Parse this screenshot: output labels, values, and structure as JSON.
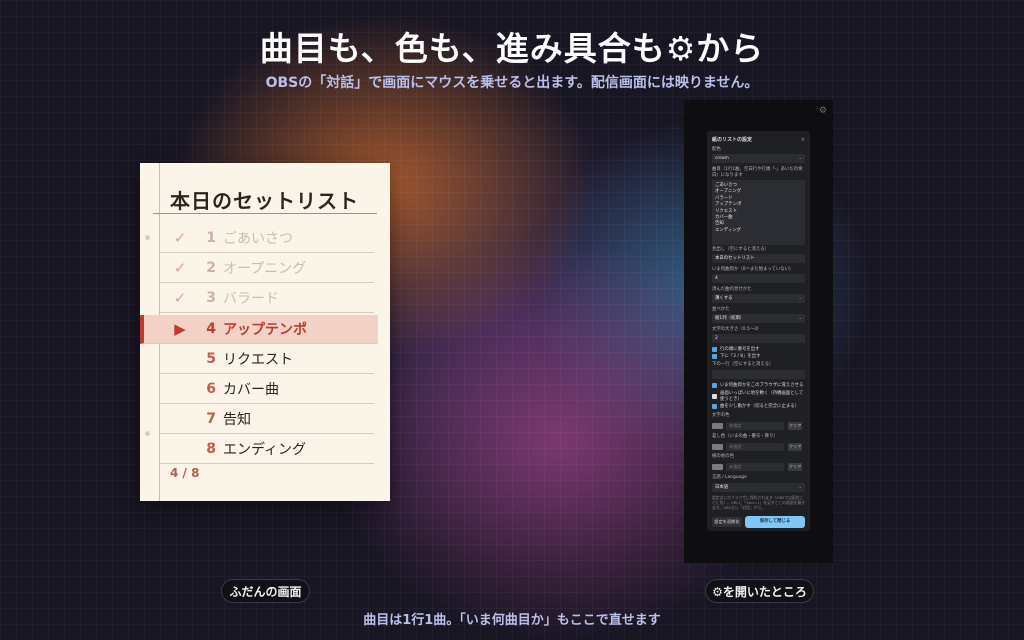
{
  "header": {
    "title": "曲目も、色も、進み具合も⚙から",
    "subtitle": "OBSの「対話」で画面にマウスを乗せると出ます。配信画面には映りません。"
  },
  "footer_text": "曲目は1行1曲。「いま何曲目か」もここで直せます",
  "captions": {
    "left": "ふだんの画面",
    "right": "⚙を開いたところ"
  },
  "setlist": {
    "title": "本日のセットリスト",
    "rows": [
      {
        "mark": "✓",
        "num": "1",
        "label": "ごあいさつ",
        "state": "done"
      },
      {
        "mark": "✓",
        "num": "2",
        "label": "オープニング",
        "state": "done"
      },
      {
        "mark": "✓",
        "num": "3",
        "label": "バラード",
        "state": "done"
      },
      {
        "mark": "▶",
        "num": "4",
        "label": "アップテンポ",
        "state": "current"
      },
      {
        "mark": "",
        "num": "5",
        "label": "リクエスト",
        "state": "todo"
      },
      {
        "mark": "",
        "num": "6",
        "label": "カバー曲",
        "state": "todo"
      },
      {
        "mark": "",
        "num": "7",
        "label": "告知",
        "state": "todo"
      },
      {
        "mark": "",
        "num": "8",
        "label": "エンディング",
        "state": "todo"
      }
    ],
    "progress": "4 / 8"
  },
  "settings": {
    "gear": "⚙",
    "title": "紙のリストの設定",
    "close": "×",
    "palette_label": "配色",
    "palette_value": "cream",
    "songs_label": "曲目（1行1曲。空白行や行頭「-」あいだの余白）になります",
    "songs_value": "ごあいさつ\nオープニング\nバラード\nアップテンポ\nリクエスト\nカバー曲\n告知\nエンディング",
    "heading_label": "見出し（空にすると消える）",
    "heading_value": "本日のセットリスト",
    "current_label": "いま何曲目か（0＝まだ始まっていない）",
    "current_value": "4",
    "done_label": "済んだ曲の見せかた",
    "done_value": "薄くする",
    "order_label": "並べかた",
    "order_value": "縦1列（初期）",
    "size_label": "文字の大きさ（0.5〜3）",
    "size_value": "2",
    "check_numbers": "行の頭に番号を出す",
    "check_count": "下に「3 / 8」を出す",
    "bottom_label": "下の一行（空にすると消える）",
    "bottom_value": "",
    "check_remember": "いま何曲目かをこのブラウザに覚えさせる",
    "check_fill": "画面いっぱいに地を敷く（待機画面として使うとき）",
    "check_anim": "曲を少し動かす（切ると完全に止まる）",
    "color_text_label": "文字の色",
    "color_accent_label": "差し色（いまの曲・番号・飾り）",
    "color_bg_label": "紙の地の色",
    "color_placeholder": "未指定",
    "clear_label": "クリア",
    "lang_label": "言語 / Language",
    "lang_value": "日本語",
    "note": "設定はこのブラウザに保存されます（OBSでは配信ごとに別）。URLに「?set=1」を足すとこの画面を開きます。OBSなら「対話」から。",
    "reset_button": "設定を初期化",
    "save_button": "保存して閉じる"
  }
}
